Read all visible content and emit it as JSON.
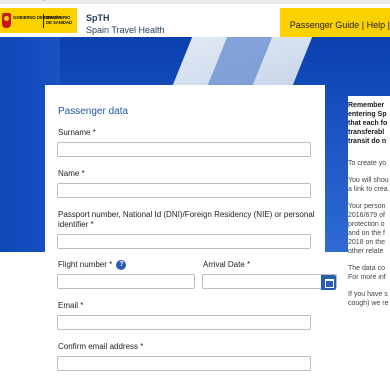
{
  "browser": {
    "url_fragment": "spaintravelhealth"
  },
  "header": {
    "gov_left": "GOBIERNO DE ESPAÑA",
    "gov_right": "MINISTERIO DE SANIDAD",
    "brand_short": "SpTH",
    "brand_long": "Spain Travel Health",
    "nav_guide": "Passenger Guide",
    "nav_sep": "|",
    "nav_help": "Help",
    "nav_sep2": "|"
  },
  "form": {
    "title": "Passenger data",
    "surname_label": "Surname *",
    "name_label": "Name *",
    "passport_label_1": "Passport number, National Id (DNI)/Foreign Residency (NIE) or personal",
    "passport_label_2": "identifier *",
    "flight_label": "Flight number *",
    "flight_help": "?",
    "arrival_label": "Arrival Date *",
    "email_label": "Email *",
    "confirm_email_label": "Confirm email address *"
  },
  "sidebar": {
    "lines": [
      {
        "text": "Remember",
        "bold": true
      },
      {
        "text": "entering Sp",
        "bold": true
      },
      {
        "text": "that each fo",
        "bold": true
      },
      {
        "text": "transferabl",
        "bold": true
      },
      {
        "text": "transit do n",
        "bold": true
      },
      {
        "text": "To create yo",
        "bold": false
      },
      {
        "text": "You will shou",
        "bold": false
      },
      {
        "text": "a link to crea",
        "bold": false
      },
      {
        "text": "Your person",
        "bold": false
      },
      {
        "text": "2016/679 of",
        "bold": false
      },
      {
        "text": "protection o",
        "bold": false
      },
      {
        "text": "and on the f",
        "bold": false
      },
      {
        "text": "2018 on the",
        "bold": false
      },
      {
        "text": "other relate",
        "bold": false
      },
      {
        "text": "The data co",
        "bold": false
      },
      {
        "text": "For more inf",
        "bold": false
      },
      {
        "text": "If you have s",
        "bold": false
      },
      {
        "text": "cough) we re",
        "bold": false
      }
    ]
  }
}
